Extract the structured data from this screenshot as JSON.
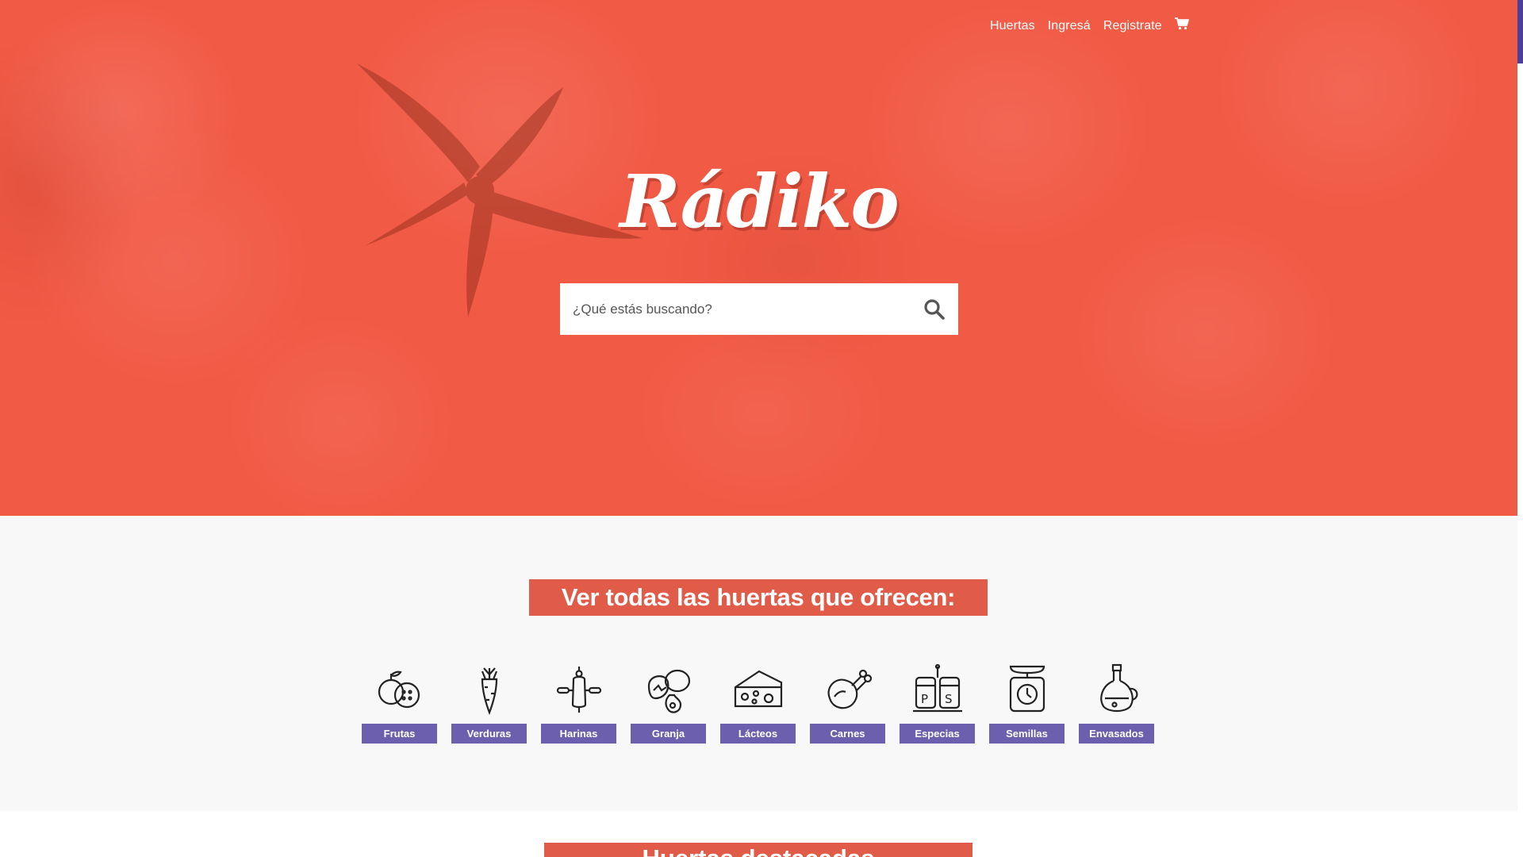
{
  "nav": {
    "items": [
      {
        "label": "Huertas"
      },
      {
        "label": "Ingresá"
      },
      {
        "label": "Registrate"
      }
    ],
    "cart_icon": "shopping-cart-icon"
  },
  "hero": {
    "logo_text": "Rádiko",
    "search": {
      "placeholder": "¿Qué estás buscando?",
      "value": "",
      "icon": "search-icon"
    }
  },
  "categories": {
    "title": "Ver todas las huertas que ofrecen:",
    "items": [
      {
        "label": "Frutas",
        "icon": "fruits-icon"
      },
      {
        "label": "Verduras",
        "icon": "carrot-icon"
      },
      {
        "label": "Harinas",
        "icon": "rolling-pin-icon"
      },
      {
        "label": "Granja",
        "icon": "eggs-icon"
      },
      {
        "label": "Lácteos",
        "icon": "cheese-icon"
      },
      {
        "label": "Carnes",
        "icon": "chicken-icon"
      },
      {
        "label": "Especias",
        "icon": "salt-pepper-icon"
      },
      {
        "label": "Semillas",
        "icon": "scale-icon"
      },
      {
        "label": "Envasados",
        "icon": "oil-bottle-icon"
      }
    ]
  },
  "featured": {
    "title": "Huertas destacadas"
  },
  "colors": {
    "hero_red": "#f15a45",
    "title_red": "#e05c49",
    "category_purple": "#6b5fae",
    "section_bg": "#f8f8f8"
  }
}
